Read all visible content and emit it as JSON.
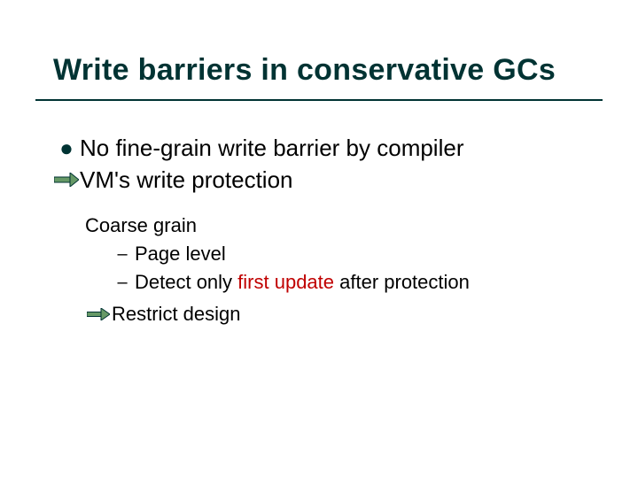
{
  "title": "Write barriers in conservative GCs",
  "lines": {
    "line1": "No fine-grain write barrier by compiler",
    "line2": "VM's write protection",
    "line3": "Coarse grain",
    "line4": "Page level",
    "line5a": "Detect only ",
    "line5b": "first update",
    "line5c": " after protection",
    "line6": "Restrict design"
  },
  "colors": {
    "accent": "#003333",
    "arrowFill": "#669966",
    "highlight": "#c00000"
  }
}
